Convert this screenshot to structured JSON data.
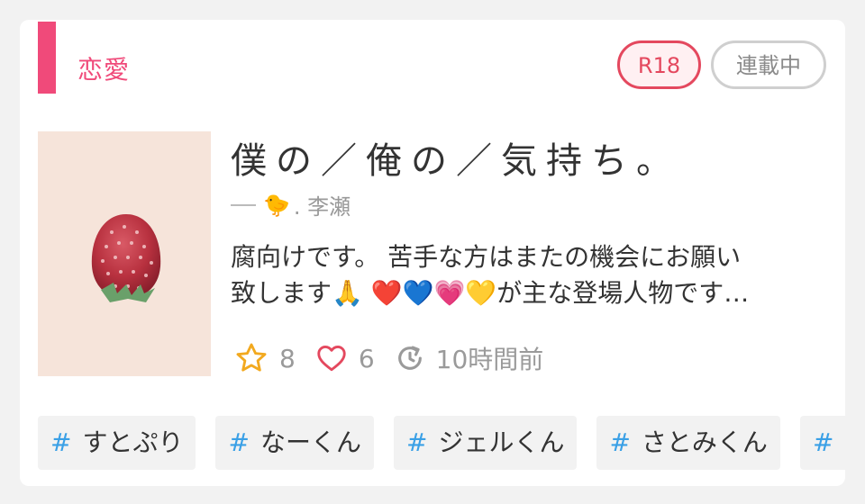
{
  "card": {
    "genre": "恋愛",
    "badges": {
      "rating": "R18",
      "status": "連載中"
    },
    "title": "僕の／俺の／気持ち。",
    "author": {
      "emoji": "🐤",
      "name": ". 李瀬"
    },
    "description": {
      "line1": "腐向けです。 苦手な方はまたの機会にお願い",
      "line2": "致します🙏 ❤️💙💗💛が主な登場人物です…"
    },
    "stats": {
      "stars": "8",
      "likes": "6",
      "updated": "10時間前"
    },
    "tags": [
      "すとぷり",
      "なーくん",
      "ジェルくん",
      "さとみくん"
    ],
    "tag_symbol": "#",
    "colors": {
      "accent": "#f04a7a",
      "rating": "#e4485e",
      "hash": "#3aa0e6",
      "star": "#f2a91f"
    }
  }
}
